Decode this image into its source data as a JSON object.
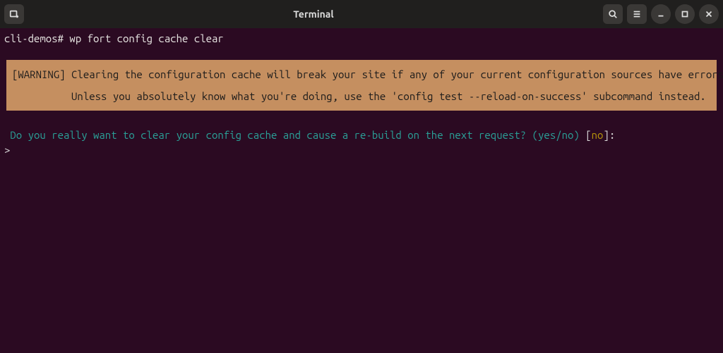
{
  "window": {
    "title": "Terminal"
  },
  "terminal": {
    "prompt": "cli-demos#",
    "command": "wp fort config cache clear",
    "warning": {
      "tag": "[WARNING]",
      "line1": "Clearing the configuration cache will break your site if any of your current configuration sources have errors.",
      "line2": "Unless you absolutely know what you're doing, use the 'config test --reload-on-success' subcommand instead."
    },
    "question": {
      "text": "Do you really want to clear your config cache and cause a re-build on the next request?",
      "options": "(yes/no)",
      "bracket_open": "[",
      "default": "no",
      "bracket_close": "]:"
    },
    "input_caret": ">"
  }
}
